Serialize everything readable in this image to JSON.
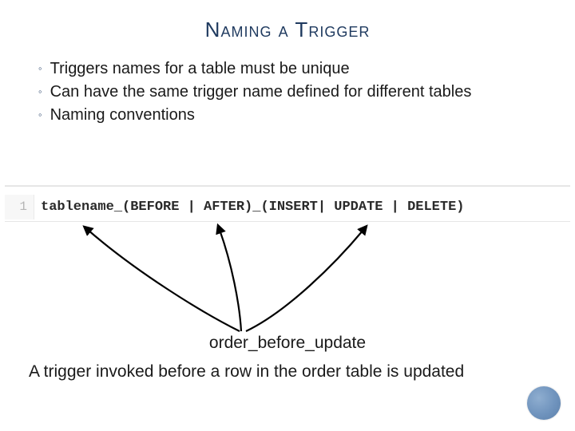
{
  "title": "Naming a Trigger",
  "bullets": {
    "b1": "Triggers names for a table must be unique",
    "b2": "Can have the same trigger name defined for different tables",
    "b3": "Naming conventions"
  },
  "code": {
    "lineno": "1",
    "text": "tablename_(BEFORE | AFTER)_(INSERT| UPDATE | DELETE)"
  },
  "example": {
    "name": "order_before_update",
    "description": "A trigger invoked before a row in the order table is updated"
  }
}
